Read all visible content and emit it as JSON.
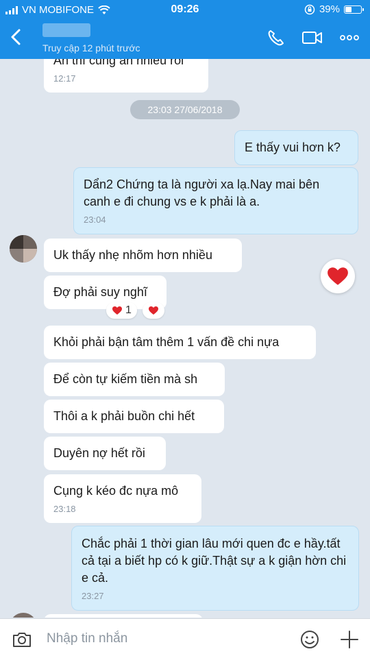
{
  "status_bar": {
    "carrier": "VN MOBIFONE",
    "time": "09:26",
    "battery": "39%",
    "battery_level": 0.39
  },
  "header": {
    "last_seen": "Truy cập 12 phút trước"
  },
  "chat": {
    "top_partial_text": "Ăn thì cũng ăn nhiều rồi",
    "top_partial_time": "12:17",
    "date_separator": "23:03 27/06/2018",
    "messages": [
      {
        "text": "E thấy vui hơn k?"
      },
      {
        "text": "Dẩn2 Chứng ta là người xa lạ.Nay mai bên canh e đi chung vs e k phải là a.",
        "time": "23:04"
      },
      {
        "text": "Uk thấy nhẹ nhõm hơn nhiều"
      },
      {
        "text": "Đợ phải suy nghĩ",
        "reaction_count": "1"
      },
      {
        "text": "Khỏi phải bận tâm thêm 1 vấn đề chi nựa"
      },
      {
        "text": "Để còn tự kiếm tiền mà sh"
      },
      {
        "text": "Thôi a k phải buồn chi hết"
      },
      {
        "text": "Duyên nợ hết rồi"
      },
      {
        "text": "Cụng k kéo đc nựa mô",
        "time": "23:18"
      },
      {
        "text": "Chắc phải 1 thời gian lâu mới quen đc e hầy.tất cả tại a biết hp có k giữ.Thật sự a k giận hờn chi e cả.",
        "time": "23:27"
      }
    ]
  },
  "composer": {
    "placeholder": "Nhập tin nhắn"
  },
  "colors": {
    "header": "#1c8ee6",
    "background": "#dfe6ee",
    "outgoing_bubble": "#d5edfb",
    "incoming_bubble": "#ffffff",
    "heart": "#e0252c"
  },
  "icons": [
    "back-chevron-icon",
    "phone-icon",
    "video-camera-icon",
    "more-icon",
    "heart-icon",
    "camera-icon",
    "emoji-icon",
    "plus-icon"
  ]
}
